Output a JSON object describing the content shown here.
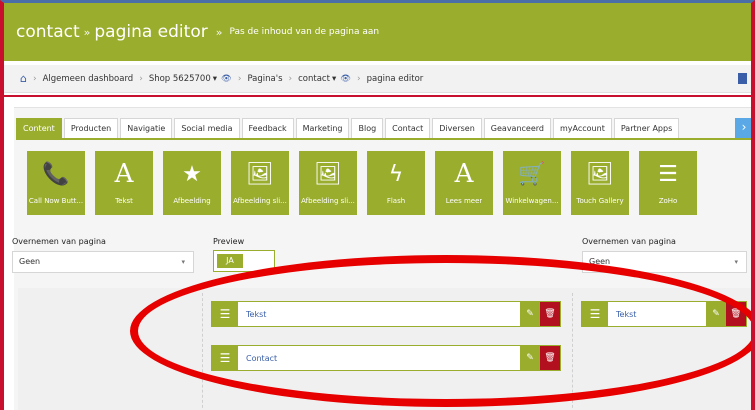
{
  "header": {
    "title": "contact",
    "sep": "»",
    "subtitle": "pagina editor",
    "sep2": "»",
    "description": "Pas de inhoud van de pagina aan"
  },
  "breadcrumb": {
    "home_icon": "home-icon",
    "items": [
      "Algemeen dashboard",
      "Shop 5625700",
      "Pagina's",
      "contact",
      "pagina editor"
    ],
    "chev": "›",
    "caret": "▾",
    "eye": "👁"
  },
  "tabs": [
    "Content",
    "Producten",
    "Navigatie",
    "Social media",
    "Feedback",
    "Marketing",
    "Blog",
    "Contact",
    "Diversen",
    "Geavanceerd",
    "myAccount",
    "Partner Apps"
  ],
  "tab_next": "›",
  "widgets": [
    {
      "icon": "📞",
      "label": "Call Now Butt..."
    },
    {
      "icon": "A",
      "label": "Tekst"
    },
    {
      "icon": "★",
      "label": "Afbeelding"
    },
    {
      "icon": "🖼",
      "label": "Afbeelding sli..."
    },
    {
      "icon": "🖼",
      "label": "Afbeelding sli..."
    },
    {
      "icon": "ϟ",
      "label": "Flash"
    },
    {
      "icon": "A",
      "label": "Lees meer"
    },
    {
      "icon": "🛒",
      "label": "Winkelwagen..."
    },
    {
      "icon": "🖼",
      "label": "Touch Gallery"
    },
    {
      "icon": "☰",
      "label": "ZoHo"
    }
  ],
  "left": {
    "label": "Overnemen van pagina",
    "value": "Geen"
  },
  "preview": {
    "label": "Preview",
    "toggle": "JA"
  },
  "right": {
    "label": "Overnemen van pagina",
    "value": "Geen"
  },
  "blocks": {
    "col2_a": "Tekst",
    "col2_b": "Contact",
    "col3_a": "Tekst"
  },
  "icons": {
    "handle": "☰",
    "edit": "✎",
    "delete": "🗑",
    "caret": "▾"
  },
  "colors": {
    "accent": "#9aad2c",
    "danger": "#b2101e",
    "link": "#3a5ea8",
    "annotation": "#e60000"
  }
}
